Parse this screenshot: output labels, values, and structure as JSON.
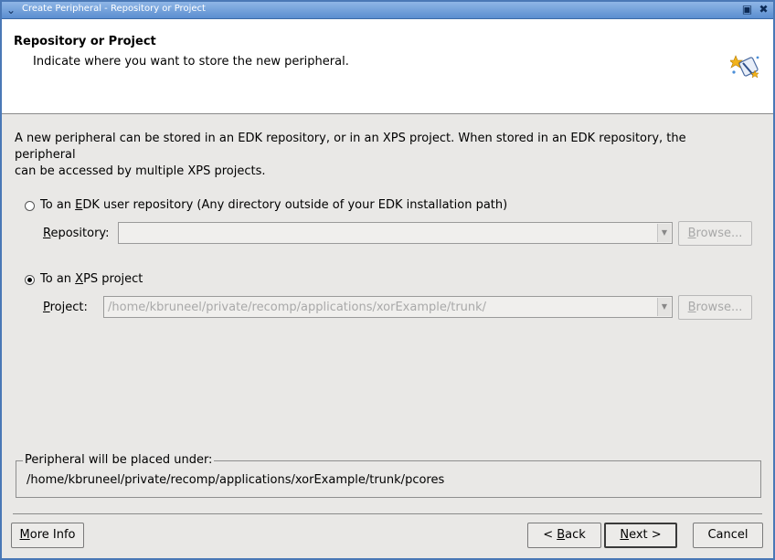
{
  "window": {
    "title": "Create Peripheral - Repository or Project",
    "icons": {
      "system_menu": "chevron-down-icon",
      "maximize": "maximize-icon",
      "close": "close-icon"
    }
  },
  "header": {
    "title": "Repository or Project",
    "description": "Indicate where you want to store the new peripheral.",
    "icon": "wizard-magic-icon"
  },
  "intro": {
    "line1": "A new peripheral can be stored in an EDK repository, or in an XPS project. When stored in an EDK repository, the peripheral",
    "line2": "can be accessed by multiple XPS projects."
  },
  "options": {
    "edk": {
      "pre": "To an ",
      "mnemonic": "E",
      "post": "DK user repository (Any directory outside of your EDK installation path)",
      "selected": false,
      "field_mnemonic": "R",
      "field_label_rest": "epository:",
      "value": "",
      "browse_pre": "",
      "browse_mnemonic": "B",
      "browse_post": "rowse..."
    },
    "xps": {
      "pre": "To an ",
      "mnemonic": "X",
      "post": "PS project",
      "selected": true,
      "field_mnemonic": "P",
      "field_label_rest": "roject:",
      "value": "/home/kbruneel/private/recomp/applications/xorExample/trunk/",
      "browse_mnemonic": "B",
      "browse_post": "rowse..."
    }
  },
  "placement": {
    "legend": "Peripheral will be placed under:",
    "path": "/home/kbruneel/private/recomp/applications/xorExample/trunk/pcores"
  },
  "footer": {
    "more_info_mnemonic": "M",
    "more_info_rest": "ore Info",
    "back_pre": "< ",
    "back_mnemonic": "B",
    "back_post": "ack",
    "next_mnemonic": "N",
    "next_post": "ext >",
    "cancel": "Cancel"
  }
}
